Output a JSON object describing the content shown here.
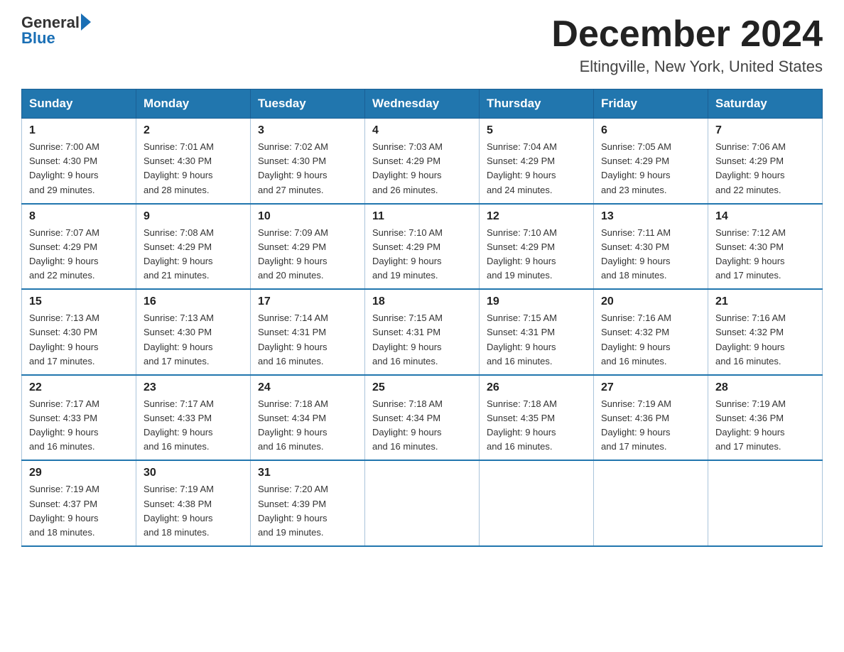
{
  "header": {
    "logo_general": "General",
    "logo_blue": "Blue",
    "month_title": "December 2024",
    "location": "Eltingville, New York, United States"
  },
  "days_of_week": [
    "Sunday",
    "Monday",
    "Tuesday",
    "Wednesday",
    "Thursday",
    "Friday",
    "Saturday"
  ],
  "weeks": [
    [
      {
        "day": "1",
        "sunrise": "7:00 AM",
        "sunset": "4:30 PM",
        "daylight": "9 hours and 29 minutes."
      },
      {
        "day": "2",
        "sunrise": "7:01 AM",
        "sunset": "4:30 PM",
        "daylight": "9 hours and 28 minutes."
      },
      {
        "day": "3",
        "sunrise": "7:02 AM",
        "sunset": "4:30 PM",
        "daylight": "9 hours and 27 minutes."
      },
      {
        "day": "4",
        "sunrise": "7:03 AM",
        "sunset": "4:29 PM",
        "daylight": "9 hours and 26 minutes."
      },
      {
        "day": "5",
        "sunrise": "7:04 AM",
        "sunset": "4:29 PM",
        "daylight": "9 hours and 24 minutes."
      },
      {
        "day": "6",
        "sunrise": "7:05 AM",
        "sunset": "4:29 PM",
        "daylight": "9 hours and 23 minutes."
      },
      {
        "day": "7",
        "sunrise": "7:06 AM",
        "sunset": "4:29 PM",
        "daylight": "9 hours and 22 minutes."
      }
    ],
    [
      {
        "day": "8",
        "sunrise": "7:07 AM",
        "sunset": "4:29 PM",
        "daylight": "9 hours and 22 minutes."
      },
      {
        "day": "9",
        "sunrise": "7:08 AM",
        "sunset": "4:29 PM",
        "daylight": "9 hours and 21 minutes."
      },
      {
        "day": "10",
        "sunrise": "7:09 AM",
        "sunset": "4:29 PM",
        "daylight": "9 hours and 20 minutes."
      },
      {
        "day": "11",
        "sunrise": "7:10 AM",
        "sunset": "4:29 PM",
        "daylight": "9 hours and 19 minutes."
      },
      {
        "day": "12",
        "sunrise": "7:10 AM",
        "sunset": "4:29 PM",
        "daylight": "9 hours and 19 minutes."
      },
      {
        "day": "13",
        "sunrise": "7:11 AM",
        "sunset": "4:30 PM",
        "daylight": "9 hours and 18 minutes."
      },
      {
        "day": "14",
        "sunrise": "7:12 AM",
        "sunset": "4:30 PM",
        "daylight": "9 hours and 17 minutes."
      }
    ],
    [
      {
        "day": "15",
        "sunrise": "7:13 AM",
        "sunset": "4:30 PM",
        "daylight": "9 hours and 17 minutes."
      },
      {
        "day": "16",
        "sunrise": "7:13 AM",
        "sunset": "4:30 PM",
        "daylight": "9 hours and 17 minutes."
      },
      {
        "day": "17",
        "sunrise": "7:14 AM",
        "sunset": "4:31 PM",
        "daylight": "9 hours and 16 minutes."
      },
      {
        "day": "18",
        "sunrise": "7:15 AM",
        "sunset": "4:31 PM",
        "daylight": "9 hours and 16 minutes."
      },
      {
        "day": "19",
        "sunrise": "7:15 AM",
        "sunset": "4:31 PM",
        "daylight": "9 hours and 16 minutes."
      },
      {
        "day": "20",
        "sunrise": "7:16 AM",
        "sunset": "4:32 PM",
        "daylight": "9 hours and 16 minutes."
      },
      {
        "day": "21",
        "sunrise": "7:16 AM",
        "sunset": "4:32 PM",
        "daylight": "9 hours and 16 minutes."
      }
    ],
    [
      {
        "day": "22",
        "sunrise": "7:17 AM",
        "sunset": "4:33 PM",
        "daylight": "9 hours and 16 minutes."
      },
      {
        "day": "23",
        "sunrise": "7:17 AM",
        "sunset": "4:33 PM",
        "daylight": "9 hours and 16 minutes."
      },
      {
        "day": "24",
        "sunrise": "7:18 AM",
        "sunset": "4:34 PM",
        "daylight": "9 hours and 16 minutes."
      },
      {
        "day": "25",
        "sunrise": "7:18 AM",
        "sunset": "4:34 PM",
        "daylight": "9 hours and 16 minutes."
      },
      {
        "day": "26",
        "sunrise": "7:18 AM",
        "sunset": "4:35 PM",
        "daylight": "9 hours and 16 minutes."
      },
      {
        "day": "27",
        "sunrise": "7:19 AM",
        "sunset": "4:36 PM",
        "daylight": "9 hours and 17 minutes."
      },
      {
        "day": "28",
        "sunrise": "7:19 AM",
        "sunset": "4:36 PM",
        "daylight": "9 hours and 17 minutes."
      }
    ],
    [
      {
        "day": "29",
        "sunrise": "7:19 AM",
        "sunset": "4:37 PM",
        "daylight": "9 hours and 18 minutes."
      },
      {
        "day": "30",
        "sunrise": "7:19 AM",
        "sunset": "4:38 PM",
        "daylight": "9 hours and 18 minutes."
      },
      {
        "day": "31",
        "sunrise": "7:20 AM",
        "sunset": "4:39 PM",
        "daylight": "9 hours and 19 minutes."
      },
      null,
      null,
      null,
      null
    ]
  ]
}
